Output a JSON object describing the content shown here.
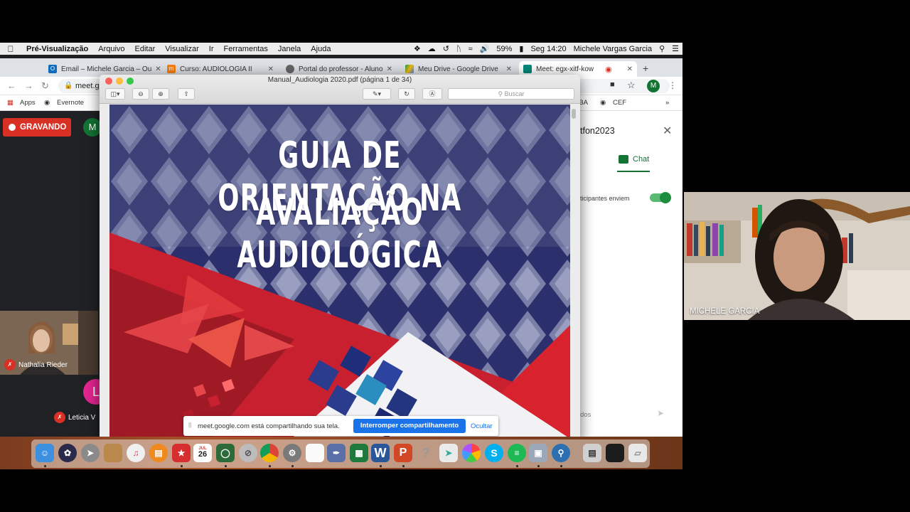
{
  "menubar": {
    "app": "Pré-Visualização",
    "items": [
      "Arquivo",
      "Editar",
      "Visualizar",
      "Ir",
      "Ferramentas",
      "Janela",
      "Ajuda"
    ],
    "battery": "59%",
    "clock": "Seg 14:20",
    "user": "Michele Vargas Garcia"
  },
  "browser": {
    "tabs": [
      {
        "label": "Email – Michele Garcia – Ou",
        "icon": "outlook-icon"
      },
      {
        "label": "Curso: AUDIOLOGIA II",
        "icon": "moodle-icon"
      },
      {
        "label": "Portal do professor - Aluno",
        "icon": "globe-icon"
      },
      {
        "label": "Meu Drive - Google Drive",
        "icon": "drive-icon"
      },
      {
        "label": "Meet: egx-xitf-kow",
        "icon": "meet-icon"
      }
    ],
    "url": "meet.g",
    "profile_initial": "M",
    "bookmarks": [
      "Apps",
      "Evernote",
      "ABA",
      "CEF"
    ]
  },
  "meet": {
    "recording_label": "GRAVANDO",
    "self_initial": "M",
    "participants": [
      {
        "name": "Nathalia Rieder"
      },
      {
        "name": "Leticia V",
        "initial": "L"
      }
    ],
    "chat": {
      "title_fragment": "tfon2023",
      "tab_label": "Chat",
      "allow_text": "ticipantes enviem",
      "input_fragment": "dos"
    },
    "share_bar": {
      "text": "meet.google.com está compartilhando sua tela.",
      "stop_label": "Interromper compartilhamento",
      "hide_label": "Ocultar"
    }
  },
  "preview": {
    "window_title": "Manual_Audiologia 2020.pdf (página 1 de 34)",
    "search_placeholder": "Buscar",
    "cover_line1": "GUIA DE ORIENTAÇÃO NA",
    "cover_line2": "AVALIAÇÃO AUDIOLÓGICA"
  },
  "dock": {
    "calendar_day": "26",
    "calendar_month": "JUL"
  },
  "camera": {
    "name": "MICHELE GARCIA"
  },
  "colors": {
    "record_red": "#d93025",
    "meet_green": "#137333",
    "share_blue": "#1a73e8",
    "cover_navy": "#2b2f6b",
    "cover_red": "#c8202f"
  }
}
